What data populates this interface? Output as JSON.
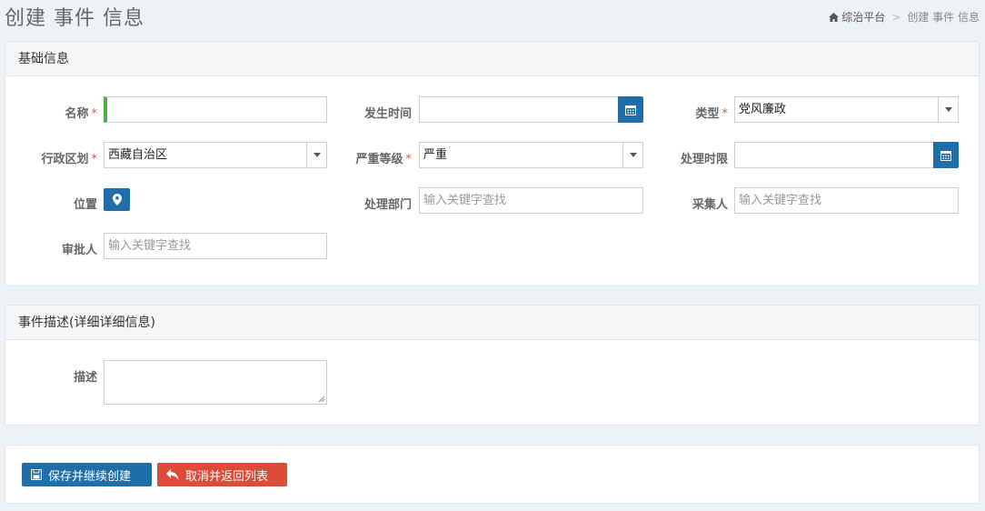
{
  "header": {
    "title": "创建 事件 信息",
    "breadcrumb": {
      "home": "综治平台",
      "separator": ">",
      "current": "创建 事件 信息"
    }
  },
  "section_basic": {
    "title": "基础信息",
    "name": {
      "label": "名称",
      "required": "*",
      "value": ""
    },
    "occur_time": {
      "label": "发生时间",
      "value": ""
    },
    "type": {
      "label": "类型",
      "required": "*",
      "value": "党风廉政"
    },
    "region": {
      "label": "行政区划",
      "required": "*",
      "value": "西藏自治区"
    },
    "severity": {
      "label": "严重等级",
      "required": "*",
      "value": "严重"
    },
    "deadline": {
      "label": "处理时限",
      "value": ""
    },
    "location": {
      "label": "位置"
    },
    "dept": {
      "label": "处理部门",
      "placeholder": "输入关键字查找"
    },
    "collector": {
      "label": "采集人",
      "placeholder": "输入关键字查找"
    },
    "approver": {
      "label": "审批人",
      "placeholder": "输入关键字查找"
    }
  },
  "section_desc": {
    "title": "事件描述(详细详细信息)",
    "desc": {
      "label": "描述",
      "value": ""
    }
  },
  "actions": {
    "save_label": "保存并继续创建",
    "cancel_label": "取消并返回列表"
  },
  "colors": {
    "primary": "#1f6eaa",
    "danger": "#dd4b39",
    "required": "#e0574c",
    "focus": "#4caf50"
  }
}
